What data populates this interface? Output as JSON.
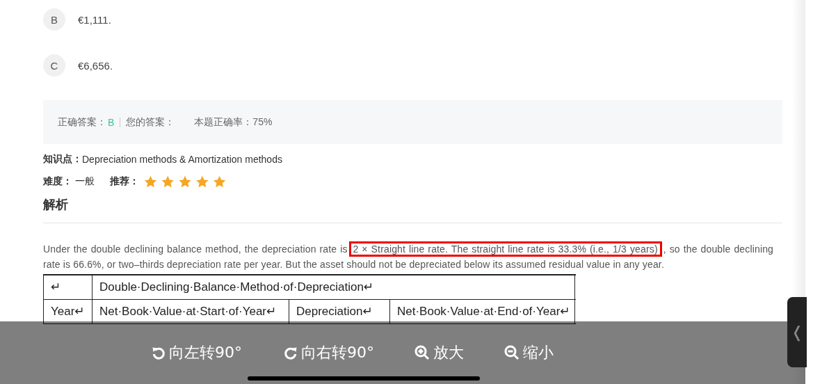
{
  "options": [
    {
      "letter": "B",
      "text": "€1,111."
    },
    {
      "letter": "C",
      "text": "€6,656."
    }
  ],
  "answer_bar": {
    "correct_label": "正确答案：",
    "correct_value": "B",
    "your_label": "您的答案：",
    "accuracy": "本题正确率：75%"
  },
  "knowledge": {
    "label": "知识点：",
    "value": "Depreciation methods & Amortization methods"
  },
  "difficulty": {
    "label": "难度：",
    "value": "一般"
  },
  "recommend": {
    "label": "推荐：",
    "stars": 5
  },
  "analysis_title": "解析",
  "explanation": {
    "before": "Under the double declining balance method, the depreciation rate is ",
    "highlighted": "2 × Straight line rate. The straight line rate is 33.3% (i.e., 1/3 years)",
    "after": ", so the double declining rate is 66.6%, or two–thirds depreciation rate per year. But the asset should not be depreciated below its assumed residual value in any year."
  },
  "table": {
    "rows": [
      [
        "↵",
        "Double·Declining·Balance·Method·of·Depreciation↵"
      ],
      [
        "Year↵",
        "Net·Book·Value·at·Start·of·Year↵",
        "Depreciation↵",
        "Net·Book·Value·at·End·of·Year↵"
      ]
    ]
  },
  "viewer_toolbar": [
    {
      "kind": "rotate-left",
      "label": "向左转90°"
    },
    {
      "kind": "rotate-right",
      "label": "向右转90°"
    },
    {
      "kind": "zoom-in",
      "label": "放大"
    },
    {
      "kind": "zoom-out",
      "label": "缩小"
    }
  ],
  "side_handle": "❬"
}
